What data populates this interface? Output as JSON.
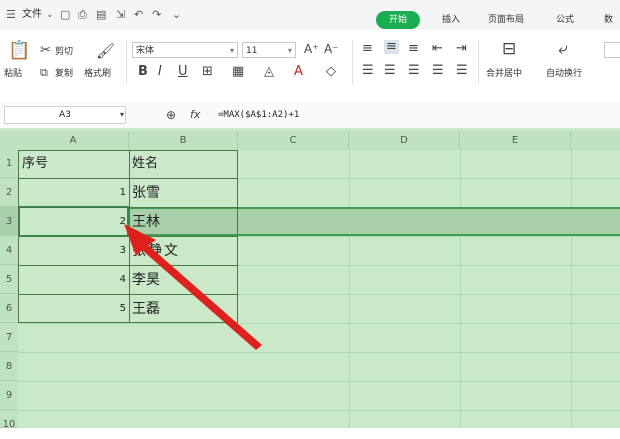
{
  "menu": {
    "file": "文件"
  },
  "tabs": {
    "active": "开始",
    "insert": "插入",
    "page_layout": "页面布局",
    "formula": "公式",
    "data": "数据"
  },
  "ribbon": {
    "paste": "粘贴",
    "cut": "剪切",
    "copy": "复制",
    "format_painter": "格式刷",
    "font_name": "宋体",
    "font_size": "11",
    "merge_center": "合并居中",
    "wrap_text": "自动换行"
  },
  "formula_bar": {
    "name_box": "A3",
    "fx": "fx",
    "formula": "=MAX($A$1:A2)+1"
  },
  "columns": [
    "A",
    "B",
    "C",
    "D",
    "E"
  ],
  "rows": [
    "1",
    "2",
    "3",
    "4",
    "5",
    "6",
    "7",
    "8",
    "9",
    "10"
  ],
  "table": {
    "header_a": "序号",
    "header_b": "姓名",
    "rows": [
      {
        "no": "1",
        "name": "张雪"
      },
      {
        "no": "2",
        "name": "王林"
      },
      {
        "no": "3",
        "name": "张静文"
      },
      {
        "no": "4",
        "name": "李昊"
      },
      {
        "no": "5",
        "name": "王磊"
      }
    ]
  },
  "colors": {
    "active_tab": "#1aad52",
    "sheet_background": "#c9e9c8",
    "selection": "#2e8b4a",
    "arrow": "#e0201c"
  }
}
